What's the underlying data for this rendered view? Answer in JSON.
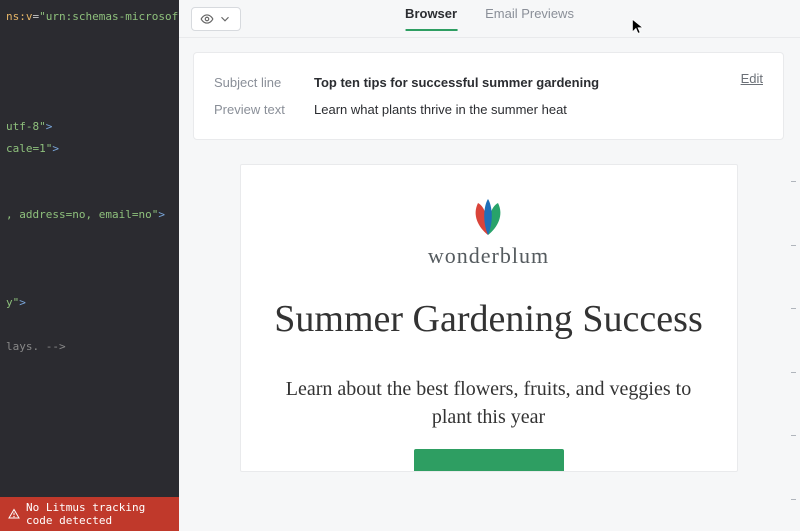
{
  "code": {
    "lines": [
      {
        "frags": [
          {
            "t": "ns:v",
            "c": "tok-attr"
          },
          {
            "t": "=",
            "c": ""
          },
          {
            "t": "\"urn:schemas-microsoft-",
            "c": "tok-str"
          }
        ]
      },
      {
        "frags": []
      },
      {
        "frags": []
      },
      {
        "frags": []
      },
      {
        "frags": []
      },
      {
        "frags": [
          {
            "t": "utf-8\"",
            "c": "tok-str"
          },
          {
            "t": ">",
            "c": "tok-tag"
          }
        ]
      },
      {
        "frags": [
          {
            "t": "cale=1\"",
            "c": "tok-str"
          },
          {
            "t": ">",
            "c": "tok-tag"
          }
        ]
      },
      {
        "frags": []
      },
      {
        "frags": []
      },
      {
        "frags": [
          {
            "t": ", address=no, email=no\"",
            "c": "tok-str"
          },
          {
            "t": ">",
            "c": "tok-tag"
          }
        ]
      },
      {
        "frags": []
      },
      {
        "frags": []
      },
      {
        "frags": []
      },
      {
        "frags": [
          {
            "t": "y\"",
            "c": "tok-str"
          },
          {
            "t": ">",
            "c": "tok-tag"
          }
        ]
      },
      {
        "frags": []
      },
      {
        "frags": [
          {
            "t": "lays. -->",
            "c": "tok-cmt"
          }
        ]
      }
    ],
    "footer": "No Litmus tracking code detected"
  },
  "tabs": {
    "browser": "Browser",
    "email": "Email Previews"
  },
  "meta": {
    "subject_label": "Subject line",
    "subject_value": "Top ten tips for successful summer gardening",
    "preview_label": "Preview text",
    "preview_value": "Learn what plants thrive in the summer heat",
    "edit": "Edit"
  },
  "email": {
    "brand": "wonderblum",
    "headline": "Summer Gardening Success",
    "subhead": "Learn about the best flowers, fruits, and veggies to plant this year"
  }
}
